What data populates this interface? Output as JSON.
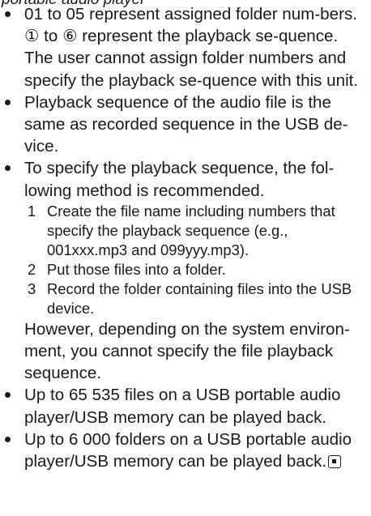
{
  "header_fragment": "portable audio player",
  "bullets": [
    {
      "text": "01 to 05 represent assigned folder num-bers. ① to ⑥ represent the playback se-quence. The user cannot assign folder numbers and specify the playback se-quence with this unit."
    },
    {
      "text": "Playback sequence of the audio file is the same as recorded sequence in the USB de-vice."
    },
    {
      "text": "To specify the playback sequence, the fol-lowing method is recommended.",
      "steps": [
        {
          "num": "1",
          "text": "Create the file name including numbers that specify the playback sequence (e.g., 001xxx.mp3 and 099yyy.mp3)."
        },
        {
          "num": "2",
          "text": "Put those files into a folder."
        },
        {
          "num": "3",
          "text": "Record the folder containing files into the USB device."
        }
      ],
      "note": "However, depending on the system environ-ment, you cannot specify the file playback sequence."
    },
    {
      "text": "Up to 65 535 files on a USB portable audio player/USB memory can be played back."
    },
    {
      "text": "Up to 6 000 folders on a USB portable audio player/USB memory can be played back."
    }
  ],
  "end_mark_icon": "end-of-section-square-icon"
}
